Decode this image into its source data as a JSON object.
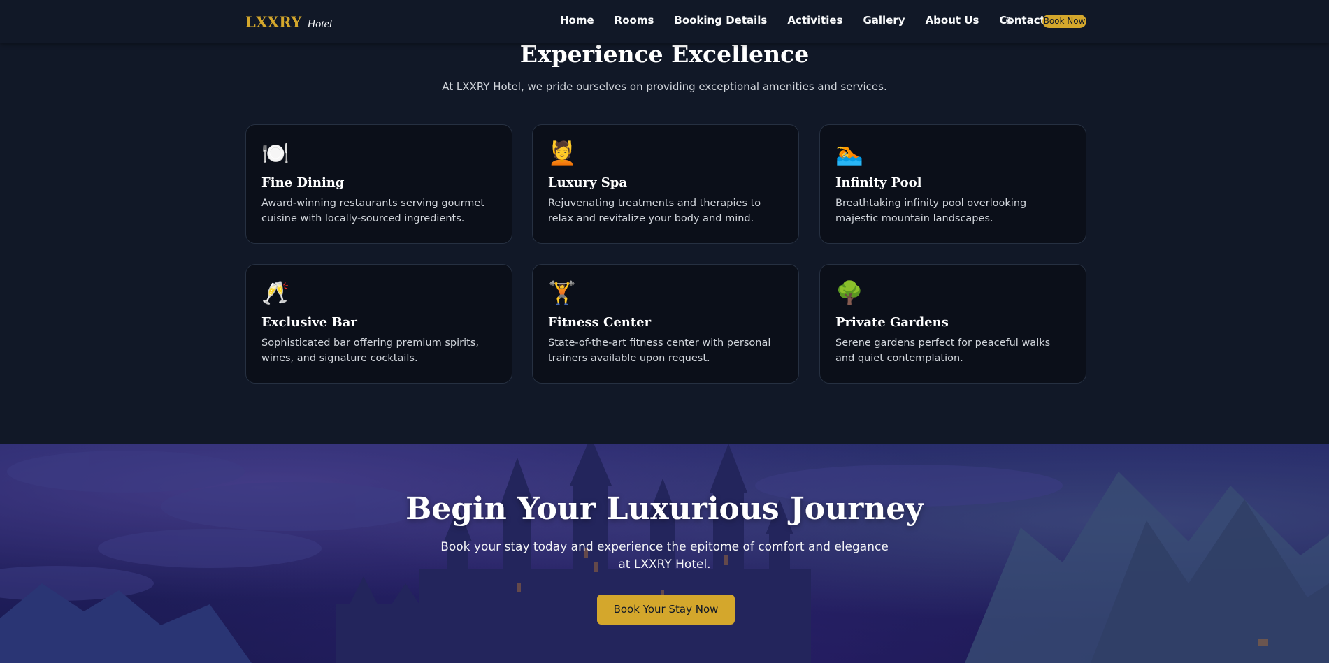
{
  "nav": {
    "brand_main": "LXXRY",
    "brand_sub": "Hotel",
    "links": [
      "Home",
      "Rooms",
      "Booking Details",
      "Activities",
      "Gallery",
      "About Us",
      "Contact"
    ],
    "book_label": "Book Now",
    "theme_icon": "moon-icon"
  },
  "amenities": {
    "title": "Experience Excellence",
    "subtitle": "At LXXRY Hotel, we pride ourselves on providing exceptional amenities and services.",
    "cards": [
      {
        "icon": "🍽️",
        "icon_name": "plate-icon",
        "title": "Fine Dining",
        "desc": "Award-winning restaurants serving gourmet cuisine with locally-sourced ingredients."
      },
      {
        "icon": "💆",
        "icon_name": "spa-icon",
        "title": "Luxury Spa",
        "desc": "Rejuvenating treatments and therapies to relax and revitalize your body and mind."
      },
      {
        "icon": "🏊",
        "icon_name": "pool-icon",
        "title": "Infinity Pool",
        "desc": "Breathtaking infinity pool overlooking majestic mountain landscapes."
      },
      {
        "icon": "🥂",
        "icon_name": "champagne-icon",
        "title": "Exclusive Bar",
        "desc": "Sophisticated bar offering premium spirits, wines, and signature cocktails."
      },
      {
        "icon": "🏋️",
        "icon_name": "weightlifter-icon",
        "title": "Fitness Center",
        "desc": "State-of-the-art fitness center with personal trainers available upon request."
      },
      {
        "icon": "🌳",
        "icon_name": "tree-icon",
        "title": "Private Gardens",
        "desc": "Serene gardens perfect for peaceful walks and quiet contemplation."
      }
    ]
  },
  "cta": {
    "title": "Begin Your Luxurious Journey",
    "subtitle": "Book your stay today and experience the epitome of comfort and elegance at LXXRY Hotel.",
    "button": "Book Your Stay Now"
  },
  "colors": {
    "accent": "#d4a72c",
    "background": "#111827",
    "card": "#0b0f19"
  }
}
